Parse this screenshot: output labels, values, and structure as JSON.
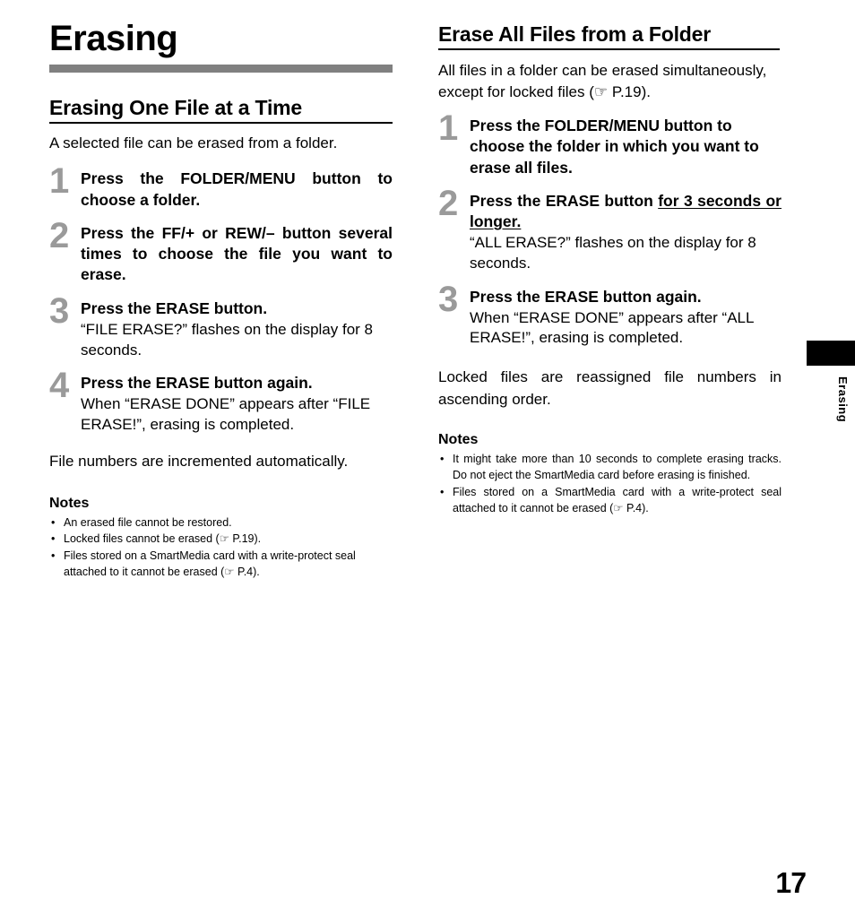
{
  "chapter": {
    "title": "Erasing"
  },
  "left_column": {
    "section_title": "Erasing One File at a Time",
    "intro": "A selected file can be erased from a folder.",
    "steps": [
      {
        "num": "1",
        "head": "Press the FOLDER/MENU button to choose a folder.",
        "body": ""
      },
      {
        "num": "2",
        "head": "Press the FF/+ or REW/– button several times to choose the file you want to erase.",
        "body": ""
      },
      {
        "num": "3",
        "head": "Press the ERASE button.",
        "body": "“FILE ERASE?” flashes on the display for 8 seconds."
      },
      {
        "num": "4",
        "head": "Press the ERASE button again.",
        "body": "When “ERASE DONE” appears after “FILE ERASE!”, erasing is completed."
      }
    ],
    "para": "File numbers are incremented automatically.",
    "notes_title": "Notes",
    "notes": [
      "An erased file cannot be restored.",
      "Locked files cannot be erased (☞ P.19).",
      "Files stored on a SmartMedia card with a write-protect seal attached to it cannot be erased (☞ P.4)."
    ]
  },
  "right_column": {
    "section_title": "Erase All Files from a Folder",
    "intro": "All files in a folder can be erased simultaneously, except for locked files (☞ P.19).",
    "steps": [
      {
        "num": "1",
        "head": "Press the FOLDER/MENU button to choose the folder in which you want to erase all files.",
        "body": ""
      },
      {
        "num": "2",
        "head_plain": "Press the ERASE button ",
        "head_underline": "for 3 seconds or longer.",
        "body": "“ALL ERASE?” flashes on the display for 8 seconds."
      },
      {
        "num": "3",
        "head": "Press the ERASE button again.",
        "body": "When “ERASE DONE” appears after “ALL ERASE!”, erasing is completed."
      }
    ],
    "para": "Locked files are reassigned file numbers in ascending order.",
    "notes_title": "Notes",
    "notes": [
      "It might take more than 10 seconds to complete erasing tracks. Do not eject the SmartMedia card before erasing is finished.",
      "Files stored on a SmartMedia card with a write-protect seal attached to it cannot be erased (☞ P.4)."
    ]
  },
  "side_tab": {
    "label": "Erasing"
  },
  "footer": {
    "page_number": "17"
  }
}
